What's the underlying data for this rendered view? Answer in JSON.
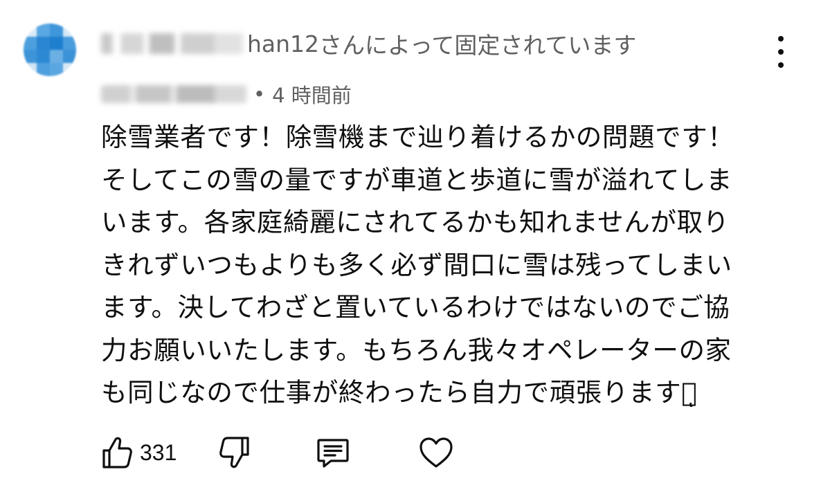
{
  "pinned": {
    "handle_suffix": "han12",
    "text": " さんによって固定されています"
  },
  "comment": {
    "timestamp": "4 時間前",
    "separator": "•",
    "body": "除雪業者です！除雪機まで辿り着けるかの問題です！そしてこの雪の量ですが車道と歩道に雪が溢れてしまいます。各家庭綺麗にされてるかも知れませんが取りきれずいつもよりも多く必ず間口に雪は残ってしまいます。決してわざと置いているわけではないのでご協力お願いいたします。もちろん我々オペレーターの家も同じなので仕事が終わったら自力で頑張りますトͅ"
  },
  "actions": {
    "like_count": "331"
  },
  "icons": {
    "menu": "more-vertical-icon",
    "like": "thumbs-up-icon",
    "dislike": "thumbs-down-icon",
    "reply": "comment-icon",
    "heart": "heart-icon"
  },
  "colors": {
    "text": "#0f0f0f",
    "secondary_text": "#606060",
    "avatar_blue": "#2f8fd8"
  }
}
